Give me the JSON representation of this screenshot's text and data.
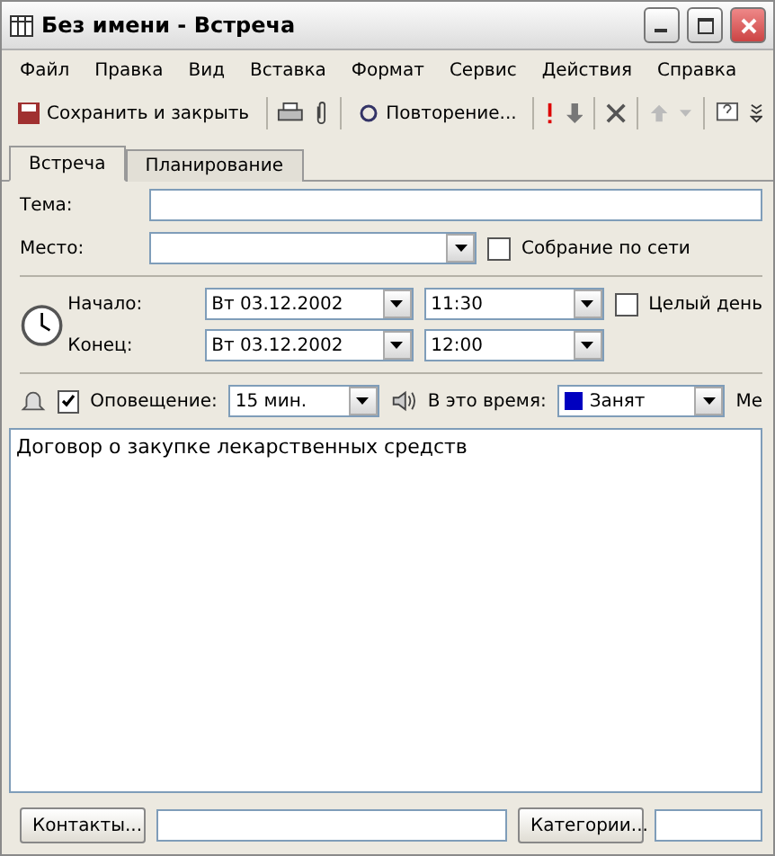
{
  "window": {
    "title": "Без имени - Встреча"
  },
  "menu": [
    "Файл",
    "Правка",
    "Вид",
    "Вставка",
    "Формат",
    "Сервис",
    "Действия",
    "Справка"
  ],
  "toolbar": {
    "save": "Сохранить и закрыть",
    "recurrence": "Повторение..."
  },
  "tabs": [
    {
      "label": "Встреча",
      "selected": true
    },
    {
      "label": "Планирование",
      "selected": false
    }
  ],
  "subject": {
    "label": "Тема:"
  },
  "location": {
    "label": "Место:",
    "online_label": "Собрание по сети",
    "online_checked": false
  },
  "start": {
    "label": "Начало:",
    "date": "Вт 03.12.2002",
    "time": "11:30",
    "all_day_label": "Целый день",
    "all_day_checked": false
  },
  "end": {
    "label": "Конец:",
    "date": "Вт 03.12.2002",
    "time": "12:00"
  },
  "reminder": {
    "checked": true,
    "label": "Оповещение:",
    "value": "15 мин.",
    "show_as_label": "В это время:",
    "show_as": {
      "label": "Занят",
      "color": "#0000c0"
    },
    "cut_label": "Ме"
  },
  "body": "Договор о закупке лекарственных средств",
  "footer": {
    "contacts": "Контакты...",
    "categories": "Категории..."
  }
}
